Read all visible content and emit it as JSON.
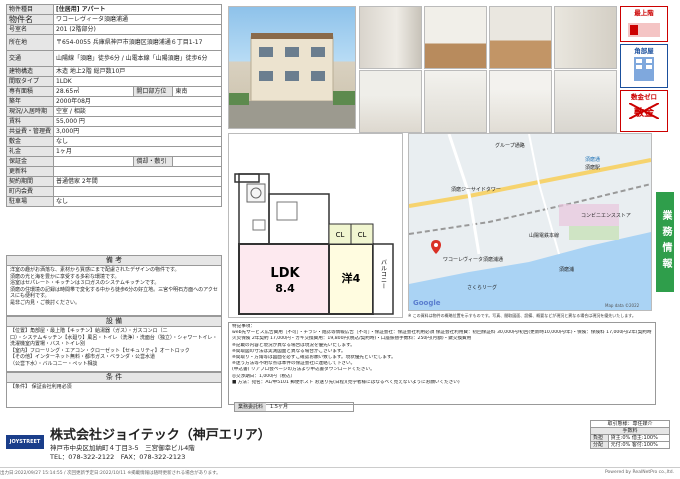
{
  "property": {
    "title_label": "物件種目",
    "title_value": "[住居用] アパート",
    "rows": [
      {
        "key": "物件名",
        "value": "ワコーレヴィータ須磨浦通",
        "cls": "title"
      },
      {
        "key": "号室名",
        "value": "201 (2階部分)"
      },
      {
        "key": "所在地",
        "value": "〒654-0055 兵庫県神戸市須磨区須磨浦通６丁目1-17",
        "cls": "tall"
      },
      {
        "key": "交通",
        "value": "山陽線「須磨」徒歩6分 / 山電本線「山陽須磨」徒歩6分",
        "cls": "tall"
      },
      {
        "key": "建物構造",
        "value": "木造 地上2階 総戸数10戸"
      },
      {
        "key": "間取タイプ",
        "value": "1LDK"
      },
      {
        "key": "専有面積",
        "value": "28.65㎡"
      },
      {
        "key": "築年",
        "value": "2000年08月"
      },
      {
        "key": "現況/入居時期",
        "value": "空室 / 相談"
      },
      {
        "key": "賃料",
        "value": "55,000 円",
        "cls": "rent"
      },
      {
        "key": "共益費・管理費",
        "value": "3,000円"
      },
      {
        "key": "敷金",
        "value": "なし"
      },
      {
        "key": "礼金",
        "value": "1ヶ月"
      },
      {
        "key": "保証金",
        "value": ""
      },
      {
        "key": "更新料",
        "value": ""
      },
      {
        "key": "契約期間",
        "value": "普通借家 2年間"
      },
      {
        "key": "町内会費",
        "value": ""
      },
      {
        "key": "駐車場",
        "value": "なし"
      }
    ],
    "opening_label": "開口部方位",
    "opening_value": "東南",
    "deposit_label": "償却・敷引",
    "deposit_value": ""
  },
  "remarks": {
    "head": "備 考",
    "lines": [
      "洋室の趣がお洒落な、素材から質感にまで配慮されたデザインの物件です。",
      "須磨の光と海を豊かに享受する多彩な環境です。",
      "浴室はセパレート・キッチンは３口ガスのシステムキッチンです。",
      "須磨の住環境の記録は時間帯で変化する中から徒歩6分の好立地。三宮や明石方面へのアクセスにも便利です。",
      "是非ご内見・ご検討ください。"
    ]
  },
  "equipment": {
    "head": "設 備",
    "lines": [
      "【位置】角部屋・最上階【キッチン】給湯器（ガス）・ガスコンロ（二",
      "口）・システムキッチン【水廻り】風呂・トイレ（洗浄）・洗面台（独立）・シャワートイレ・洗濯機室内置場・バス・トイレ別",
      "【室内】フローリング・エアコン・クローゼット【セキュリティ】オートロック",
      "【その他】インターネット無料・都市ガス・ベランダ・公営水道",
      "（公営下水）・バルコニー・ペット相談"
    ]
  },
  "conditions": {
    "head": "条 件",
    "text": "【条件】 保証会社利用必須"
  },
  "badges": {
    "top": "最上階",
    "corner": "角部屋",
    "zero": "敷金ゼロ",
    "no_deposit": "敷金"
  },
  "side_tab": "業務情報",
  "floorplan": {
    "ldk": "LDK",
    "ldk_size": "8.4",
    "room": "洋4",
    "cl": "CL",
    "balcony": "バルコニー"
  },
  "map": {
    "labels": [
      "グループ通路",
      "須磨ジーサイドタワー",
      "須磨通",
      "須磨駅",
      "ワコーレヴィータ須磨浦通",
      "須磨浦",
      "コンビニエンスストア",
      "山陽電鉄本線",
      "さくらリーグ",
      "Google"
    ],
    "copyright": "Map data ©2022",
    "caption": "※ この資料は物件の概略位置を示すものです。写真、間取図面、設備、概要などが現況と異なる場合は現況を優先いたします。"
  },
  "notes": {
    "lines": [
      "特記事項：",
      "web先サービス広告費用［不可］・チラシ・雑誌等情報広告［不可］・保証会社：保証会社利用必須 保証会社利用費：初回保証料 30,000円/初回(更新時10,000円/年)・保険：保険料 17,000円/2年(契約時)",
      "火災保険 2年契約 17,000円・カギ交換費用：19,800円(税込/契約時)・口座振替手数料：250円(月額)・鍵交換費用",
      "※記載の内容と現況が異なる場合は現況を優先いたします。",
      "※間取図の寸法は実測図面と異なる場合がございます。",
      "※間取り・方角等は図面を必ずご確認お願い致します。現状優先といたします。",
      "※迷う方法等不明な点は本件の保証会社に連絡して下さい。",
      "(申込書) リアプロ会ページの方法より申込書ダウンロードください。",
      "◎交渉期日：1,000円（税込）",
      "■ 方法：宛名：AL/甲5101 郵便ポスト お送り先(日程)(見学者様にはなるべく見えないようにお願いください)"
    ],
    "reg_label": "業務委託料",
    "reg_value": "1.5ヶ月"
  },
  "company": {
    "logo_text": "JOYSTREET",
    "name": "株式会社ジョイテック（神戸エリア）",
    "address": "神戸市中央区加納町４丁目3-5　三宮御幸ビル4階",
    "tel": "TEL：078-322-2122　FAX：078-322-2123"
  },
  "fee_table": {
    "head1": "取引態様：専任媒介",
    "head2": "手数料",
    "row1_k": "負担",
    "row1_v": "貸主:0% 借主:100%",
    "row2_k": "分配",
    "row2_v": "元付:0% 客付:100%"
  },
  "footer": {
    "left": "出力日:2022/09/27 15:14:55 / 次回更新予定日:2022/10/11 ※掲載情報は随時更新される場合があります。",
    "right": "Powered by RealNetPro co.,ltd."
  },
  "colors": {
    "badge_red": "#cc0000",
    "tab_green": "#2f9e4b",
    "map_bg": "#e9eef1",
    "water": "#aad3f4"
  }
}
